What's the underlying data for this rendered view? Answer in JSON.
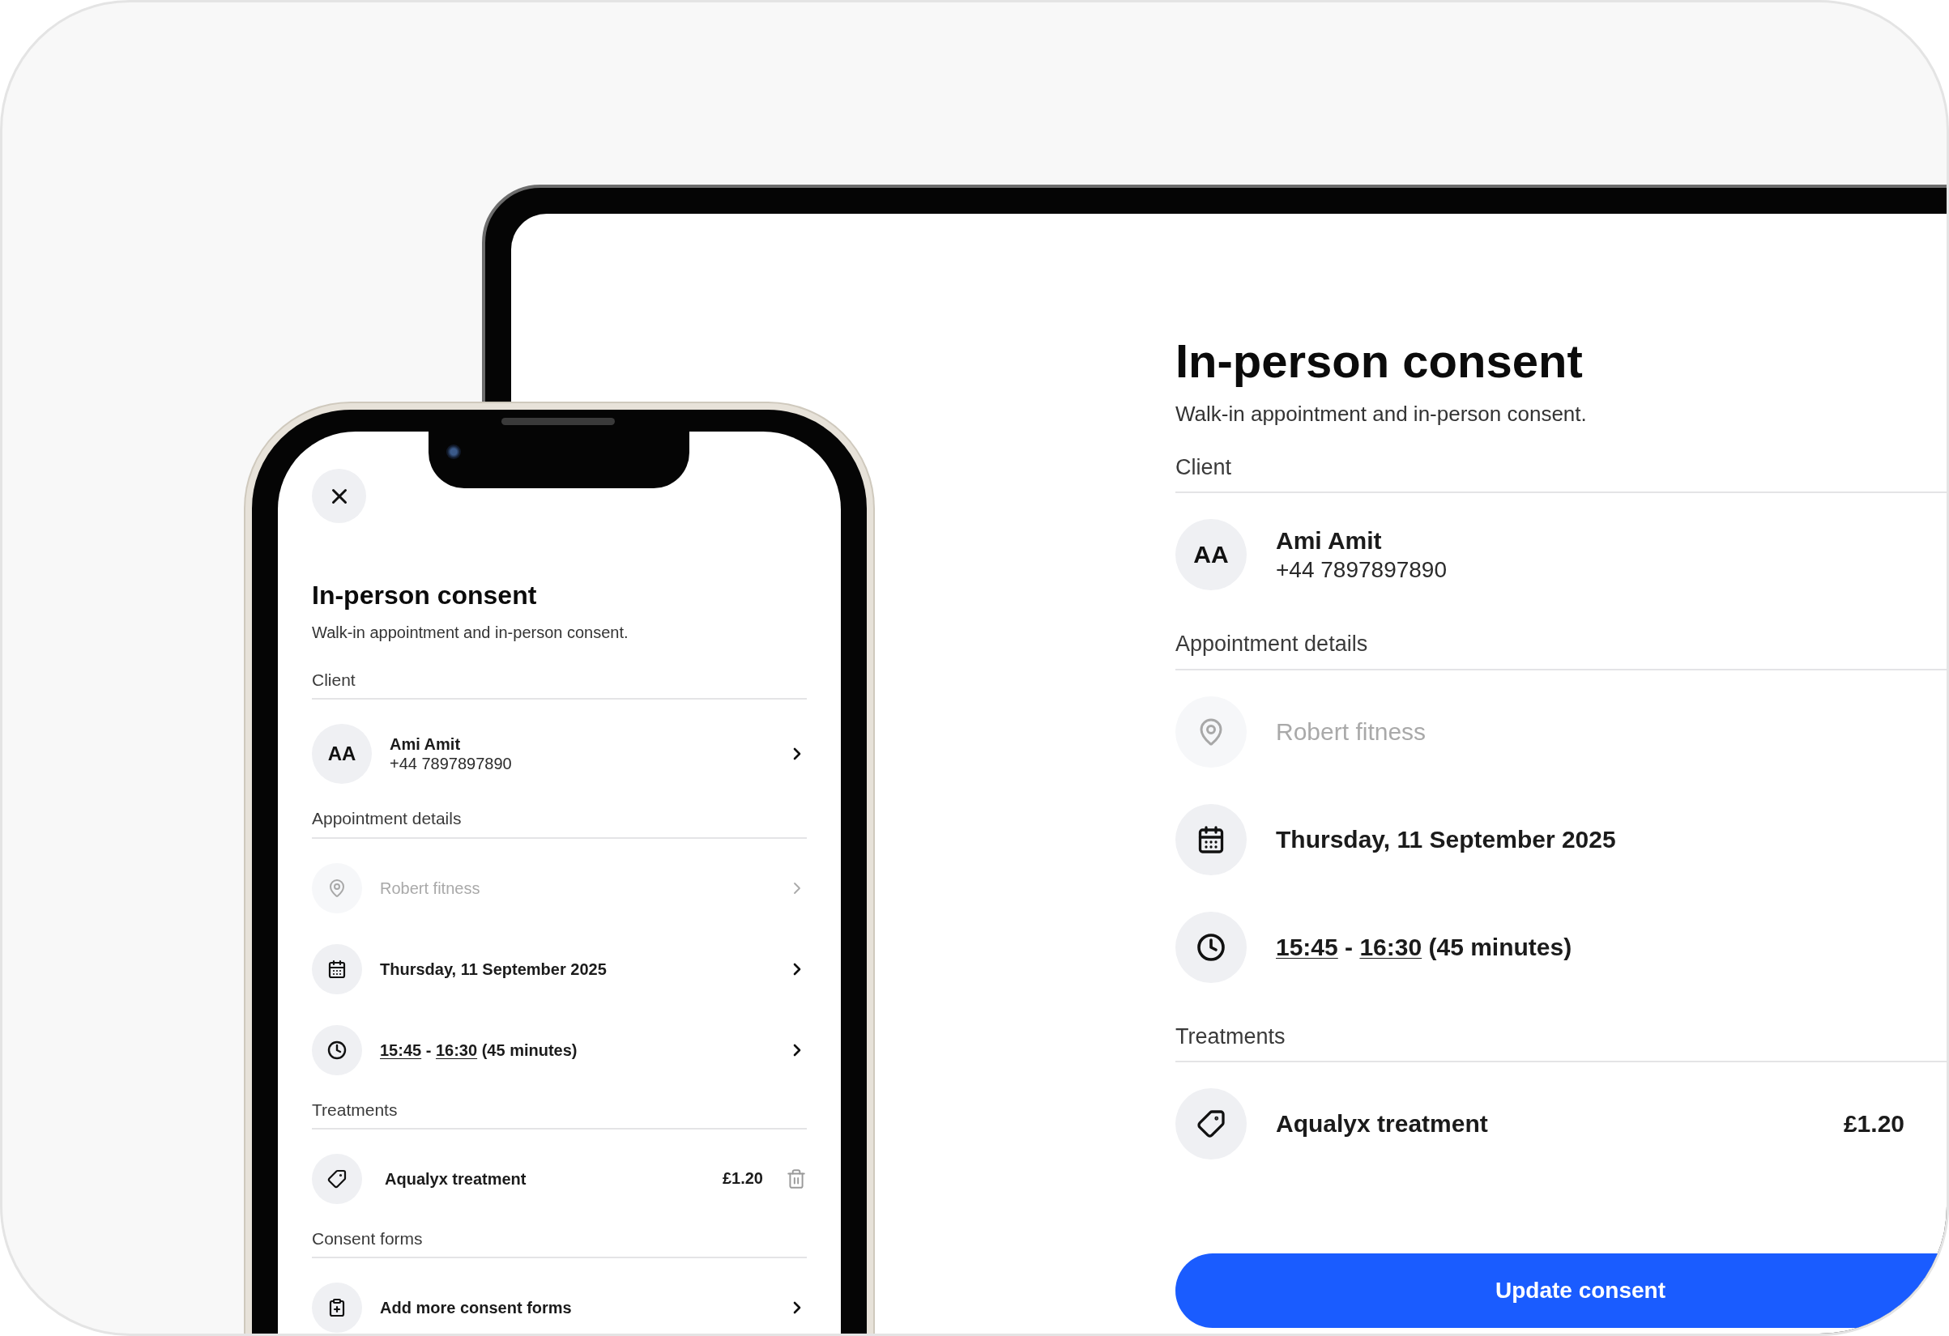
{
  "tablet": {
    "title": "In-person consent",
    "subtitle": "Walk-in appointment and in-person consent.",
    "sections": [
      {
        "label": "Client",
        "rows": [
          {
            "kind": "client",
            "initials": "AA",
            "name": "Ami Amit",
            "phone": "+44 7897897890"
          }
        ]
      },
      {
        "label": "Appointment details",
        "rows": [
          {
            "kind": "location",
            "text": "Robert fitness",
            "disabled": true
          },
          {
            "kind": "date",
            "text": "Thursday, 11 September 2025",
            "disabled": false
          },
          {
            "kind": "time",
            "start": "15:45",
            "separator": "-",
            "end": "16:30",
            "duration": "(45 minutes)",
            "disabled": false
          }
        ]
      },
      {
        "label": "Treatments",
        "rows": [
          {
            "kind": "treatment",
            "text": "Aqualyx treatment",
            "price": "£1.20"
          }
        ]
      }
    ],
    "button": "Update consent"
  },
  "phone": {
    "title": "In-person consent",
    "subtitle": "Walk-in appointment and in-person consent.",
    "sections": [
      {
        "label": "Client",
        "rows": [
          {
            "kind": "client",
            "initials": "AA",
            "name": "Ami Amit",
            "phone": "+44 7897897890"
          }
        ]
      },
      {
        "label": "Appointment details",
        "rows": [
          {
            "kind": "location",
            "text": "Robert fitness",
            "disabled": true
          },
          {
            "kind": "date",
            "text": "Thursday, 11 September 2025",
            "disabled": false
          },
          {
            "kind": "time",
            "start": "15:45",
            "separator": "-",
            "end": "16:30",
            "duration": "(45 minutes)",
            "disabled": false
          }
        ]
      },
      {
        "label": "Treatments",
        "rows": [
          {
            "kind": "treatment",
            "text": "Aqualyx treatment",
            "price": "£1.20"
          }
        ]
      },
      {
        "label": "Consent forms",
        "rows": [
          {
            "kind": "add-form",
            "text": "Add more consent forms",
            "disabled": false
          }
        ]
      }
    ]
  }
}
